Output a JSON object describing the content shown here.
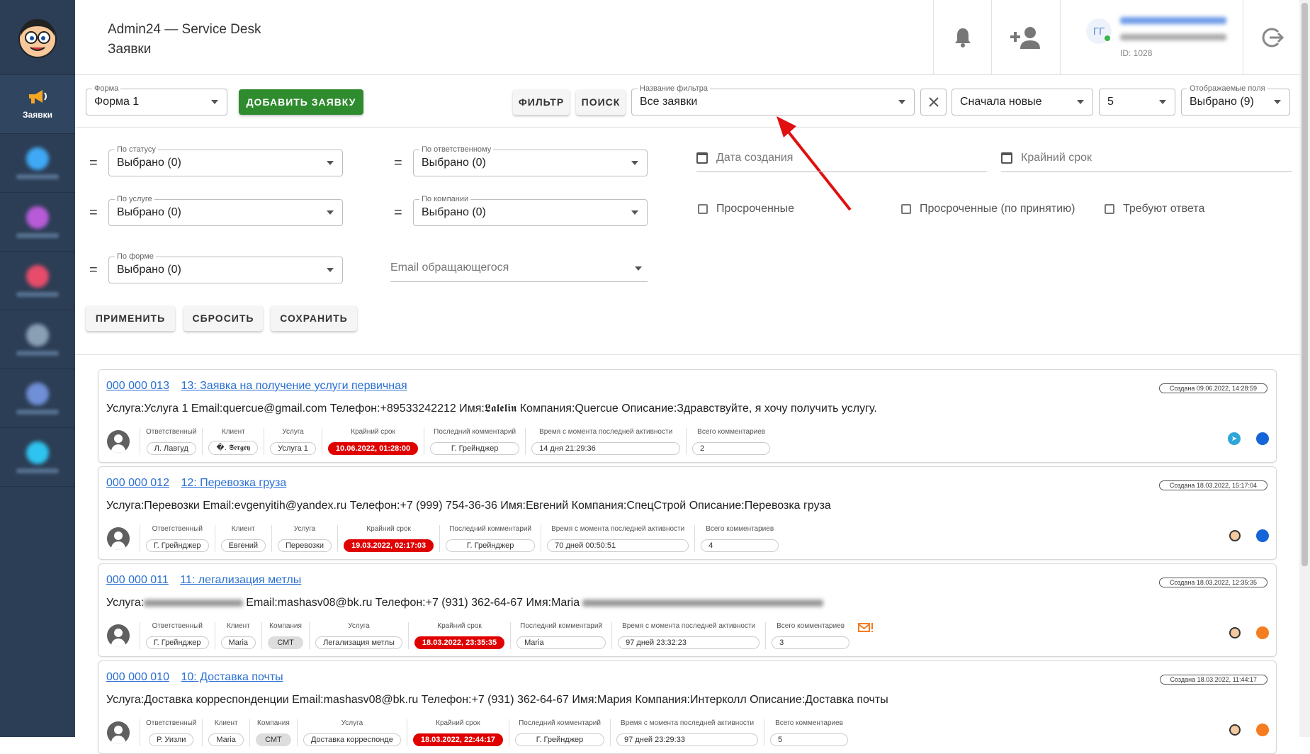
{
  "header": {
    "app_title": "Admin24 — Service Desk",
    "page_title": "Заявки",
    "user_initials": "ГГ",
    "user_id": "ID: 1028"
  },
  "sidebar": {
    "items": [
      {
        "label": "Заявки",
        "icon": "megaphone-icon",
        "active": true
      },
      {
        "label": "",
        "icon": "blurred-icon",
        "color": "#3fa9f5"
      },
      {
        "label": "",
        "icon": "blurred-icon",
        "color": "#e25bd0"
      },
      {
        "label": "",
        "icon": "blurred-icon",
        "color": "#e74c6b"
      },
      {
        "label": "",
        "icon": "blurred-icon",
        "color": "#8aa0b5"
      },
      {
        "label": "",
        "icon": "blurred-icon",
        "color": "#6f8fd6"
      },
      {
        "label": "",
        "icon": "blurred-icon",
        "color": "#2ec4f0"
      }
    ]
  },
  "toolbar": {
    "form_label": "Форма",
    "form_value": "Форма 1",
    "add_button": "ДОБАВИТЬ ЗАЯВКУ",
    "filter_button": "ФИЛЬТР",
    "search_button": "ПОИСК",
    "filter_name_label": "Название фильтра",
    "filter_name_value": "Все заявки",
    "sort_value": "Сначала новые",
    "page_size_value": "5",
    "fields_label": "Отображаемые поля",
    "fields_value": "Выбрано (9)"
  },
  "filters": {
    "status_label": "По статусу",
    "status_value": "Выбрано (0)",
    "responsible_label": "По ответственному",
    "responsible_value": "Выбрано (0)",
    "service_label": "По услуге",
    "service_value": "Выбрано (0)",
    "company_label": "По компании",
    "company_value": "Выбрано (0)",
    "form_label": "По форме",
    "form_value": "Выбрано (0)",
    "email_placeholder": "Email обращающегося",
    "created_date": "Дата создания",
    "deadline": "Крайний срок",
    "overdue": "Просроченные",
    "overdue_accept": "Просроченные (по принятию)",
    "need_reply": "Требуют ответа",
    "apply": "ПРИМЕНИТЬ",
    "reset": "СБРОСИТЬ",
    "save": "СОХРАНИТЬ"
  },
  "labels": {
    "responsible": "Ответственный",
    "client": "Клиент",
    "company": "Компания",
    "service": "Услуга",
    "deadline": "Крайний срок",
    "last_comment": "Последний комментарий",
    "since_activity": "Время с момента последней активности",
    "total_comments": "Всего комментариев"
  },
  "colors": {
    "blue_status": "#1565d8",
    "orange_status": "#f57c20",
    "deadline_red": "#e00000",
    "accent_green": "#2e8b2e"
  },
  "tickets": [
    {
      "number": "000 000 013",
      "title": "13: Заявка на получение услуги первичная",
      "created": "Создана 09.06.2022, 14:28:59",
      "desc": "Услуга:Услуга 1 Email:quercue@gmail.com Телефон:+89533242212 Имя:𝕷𝖆𝖑𝖊𝖑𝖎𝖓 Компания:Quercue Описание:Здравствуйте, я хочу получить услугу.",
      "responsible": "Л. Лавгуд",
      "client": "�. 𝕾𝖊𝖗𝖌𝖊𝖞",
      "service": "Услуга 1",
      "deadline": "10.06.2022, 01:28:00",
      "last_comment": "Г. Грейнджер",
      "since_activity": "14 дня 21:29:36",
      "total_comments": "2",
      "status_color": "#1565d8"
    },
    {
      "number": "000 000 012",
      "title": "12: Перевозка груза",
      "created": "Создана 18.03.2022, 15:17:04",
      "desc": "Услуга:Перевозки Email:evgenyitih@yandex.ru Телефон:+7 (999) 754-36-36 Имя:Евгений Компания:СпецСтрой Описание:Перевозка груза",
      "responsible": "Г. Грейнджер",
      "client": "Евгений",
      "service": "Перевозки",
      "deadline": "19.03.2022, 02:17:03",
      "last_comment": "Г. Грейнджер",
      "since_activity": "70 дней 00:50:51",
      "total_comments": "4",
      "status_color": "#1565d8"
    },
    {
      "number": "000 000 011",
      "title": "11: легализация метлы",
      "created": "Создана 18.03.2022, 12:35:35",
      "desc_pre": "Услуга:",
      "desc_mid": "Email:mashasv08@bk.ru Телефон:+7 (931) 362-64-67 Имя:Maria",
      "responsible": "Г. Грейнджер",
      "client": "Maria",
      "company": "СМТ",
      "service": "Легализация метлы",
      "deadline": "18.03.2022, 23:35:35",
      "last_comment": "Maria",
      "since_activity": "97 дней 23:32:23",
      "total_comments": "3",
      "status_color": "#f57c20"
    },
    {
      "number": "000 000 010",
      "title": "10: Доставка почты",
      "created": "Создана 18.03.2022, 11:44:17",
      "desc": "Услуга:Доставка корреспонденции Email:mashasv08@bk.ru Телефон:+7 (931) 362-64-67 Имя:Мария Компания:Интерколл Описание:Доставка почты",
      "responsible": "Р. Уизли",
      "client": "Maria",
      "company": "СМТ",
      "service": "Доставка корреспонде",
      "deadline": "18.03.2022, 22:44:17",
      "last_comment": "Г. Грейнджер",
      "since_activity": "97 дней 23:29:33",
      "total_comments": "5",
      "status_color": "#f57c20"
    }
  ]
}
